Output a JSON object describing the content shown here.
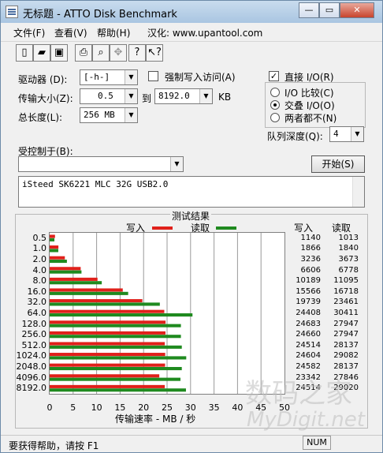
{
  "window": {
    "title": "无标题 - ATTO Disk Benchmark"
  },
  "menu": {
    "items": [
      "文件(F)",
      "查看(V)",
      "帮助(H)"
    ],
    "site_text": "汉化: www.upantool.com"
  },
  "toolbar": {
    "icons": [
      "new-icon",
      "open-icon",
      "save-icon",
      "print-icon",
      "print-preview-icon",
      "move-icon",
      "help-icon",
      "context-help-icon"
    ]
  },
  "settings": {
    "drive_label": "驱动器 (D):",
    "drive_value": "[-h-]",
    "force_write_label": "强制写入访问(A)",
    "transfer_size_label": "传输大小(Z):",
    "transfer_from": "0.5",
    "to_label": "到",
    "transfer_to": "8192.0",
    "kb_label": "KB",
    "total_length_label": "总长度(L):",
    "total_length_value": "256 MB",
    "direct_io_label": "直接 I/O(R)",
    "direct_io_checked": true,
    "io_options": [
      "I/O 比较(C)",
      "交叠 I/O(O)",
      "两者都不(N)"
    ],
    "io_selected_index": 1,
    "queue_depth_label": "队列深度(Q):",
    "queue_depth_value": "4",
    "controlled_by_label": "受控制于(B):",
    "controlled_by_value": "",
    "start_button": "开始(S)",
    "description": "iSteed SK6221 MLC 32G USB2.0"
  },
  "results": {
    "title": "测试结果",
    "legend_write": "写入",
    "legend_read": "读取",
    "col_write": "写入",
    "col_read": "读取",
    "write_color": "#e0201a",
    "read_color": "#1f8a1f",
    "xlabel": "传输速率 - MB / 秒",
    "xticks": [
      "0",
      "5",
      "10",
      "15",
      "20",
      "25",
      "30",
      "35",
      "40",
      "45",
      "50"
    ]
  },
  "chart_data": {
    "type": "bar",
    "orientation": "horizontal",
    "title": "测试结果",
    "xlabel": "传输速率 - MB / 秒",
    "xlim": [
      0,
      50
    ],
    "categories": [
      "0.5",
      "1.0",
      "2.0",
      "4.0",
      "8.0",
      "16.0",
      "32.0",
      "64.0",
      "128.0",
      "256.0",
      "512.0",
      "1024.0",
      "2048.0",
      "4096.0",
      "8192.0"
    ],
    "series": [
      {
        "name": "写入",
        "values": [
          1140,
          1866,
          3236,
          6606,
          10189,
          15566,
          19739,
          24408,
          24683,
          24660,
          24514,
          24604,
          24582,
          23342,
          24514
        ]
      },
      {
        "name": "读取",
        "values": [
          1013,
          1840,
          3673,
          6778,
          11095,
          16718,
          23461,
          30411,
          27947,
          27947,
          28137,
          29082,
          28137,
          27846,
          29020
        ]
      }
    ]
  },
  "statusbar": {
    "text": "要获得帮助，请按 F1",
    "num": "NUM"
  },
  "watermark": {
    "line1": "数码之家",
    "line2": "MyDigit.net"
  }
}
